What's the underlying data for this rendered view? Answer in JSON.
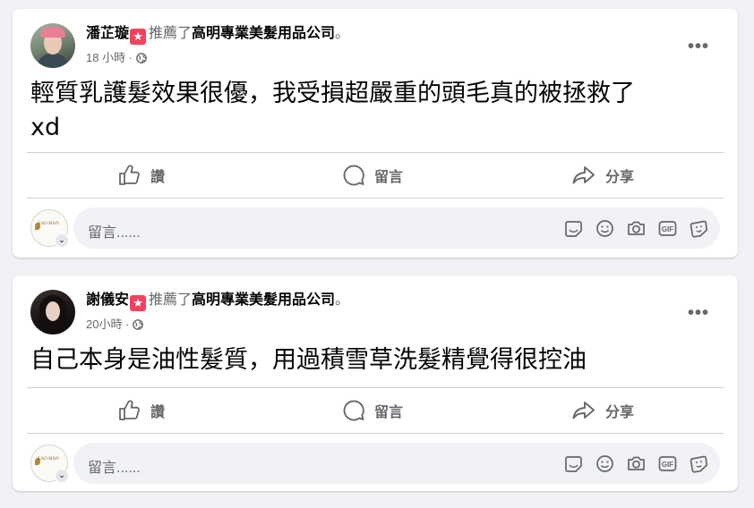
{
  "posts": [
    {
      "author": "潘芷璇",
      "recommend_text": "推薦了",
      "page_name": "高明專業美髮用品公司",
      "period": "。",
      "time": "18 小時 ·",
      "text_line1": "輕質乳護髮效果很優，我受損超嚴重的頭毛真的被拯救了",
      "text_line2": "xd"
    },
    {
      "author": "謝儀安",
      "recommend_text": "推薦了",
      "page_name": "高明專業美髮用品公司",
      "period": "。",
      "time": "20小時 ·",
      "text_line1": "自己本身是油性髮質，用過積雪草洗髮精覺得很控油",
      "text_line2": ""
    }
  ],
  "actions": {
    "like": "讚",
    "comment": "留言",
    "share": "分享"
  },
  "comment_placeholder": "留言......",
  "page_logo_text": "KAO MAN",
  "more_label": "•••",
  "icons": [
    "thumbs-up-icon",
    "comment-bubble-icon",
    "share-arrow-icon",
    "sticker-icon",
    "emoji-icon",
    "camera-icon",
    "gif-icon",
    "avatar-sticker-icon",
    "globe-icon"
  ],
  "colors": {
    "background": "#f0f2f5",
    "card": "#ffffff",
    "secondary_text": "#65676b",
    "recommend_badge": "#f3425f"
  }
}
